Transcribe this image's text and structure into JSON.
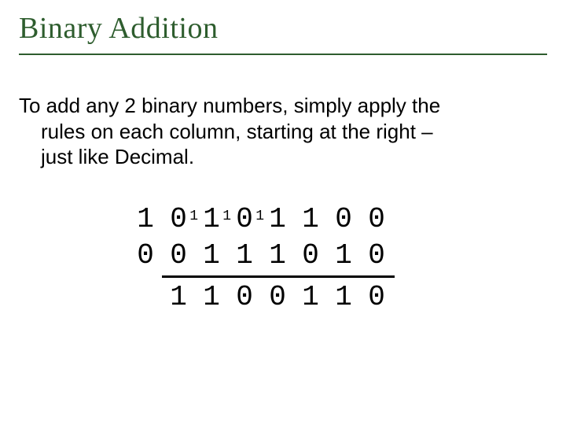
{
  "title": "Binary Addition",
  "body_line1": "To add any 2 binary numbers, simply apply the",
  "body_line2": "rules on each column, starting at the right –",
  "body_line3": "just like Decimal.",
  "row1": {
    "d0": "1",
    "d1": "0",
    "d2": "1",
    "d3": "0",
    "d4": "1",
    "d5": "1",
    "d6": "0",
    "d7": "0"
  },
  "carry": {
    "c1": "1",
    "c2": "1",
    "c3": "1"
  },
  "row2": {
    "d0": "0",
    "d1": "0",
    "d2": "1",
    "d3": "1",
    "d4": "1",
    "d5": "0",
    "d6": "1",
    "d7": "0"
  },
  "row3": {
    "d1": "1",
    "d2": "1",
    "d3": "0",
    "d4": "0",
    "d5": "1",
    "d6": "1",
    "d7": "0"
  }
}
